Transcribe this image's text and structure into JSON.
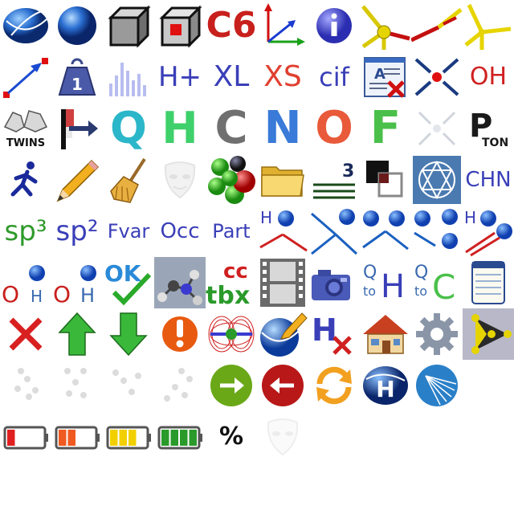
{
  "icons": {
    "r0": [
      "ellipsoid-icon",
      "sphere-icon",
      "cube-icon",
      "cube-with-atom-icon",
      "c6-label",
      "axes-icon",
      "info-icon",
      "bond-fragment-icon",
      "bond-fragment-2-icon",
      "bond-fragment-3-icon"
    ],
    "r1": [
      "arrow-bond-icon",
      "weight-1-icon",
      "histogram-icon",
      "h-plus-label",
      "xl-label",
      "xs-label",
      "cif-label",
      "text-remove-icon",
      "cross-atom-icon",
      "oh-label"
    ],
    "r2": [
      "twins-icon",
      "flag-arrow-icon",
      "q-letter-icon",
      "h-letter-icon",
      "c-letter-icon",
      "n-letter-icon",
      "o-letter-icon",
      "f-letter-icon",
      "collapse-arrows-icon",
      "pton-icon"
    ],
    "r3": [
      "run-icon",
      "pencil-icon",
      "broom-icon",
      "mask-icon",
      "atoms-cluster-icon",
      "folder-icon",
      "lines-3-icon",
      "overlap-squares-icon",
      "symmetry-icon",
      "chn-label"
    ],
    "r4": [
      "sp3-label",
      "sp2-label",
      "fvar-label",
      "occ-label",
      "part-label",
      "h-on-bond-icon",
      "bond-angle-icon",
      "bond-angle-2-icon",
      "bond-angle-3-icon",
      "h-atom-bond-icon"
    ],
    "r5": [
      "oh-bond-icon",
      "oh-bond-2-icon",
      "ok-check-icon",
      "molecule-photo-icon",
      "tbx-cc-icon",
      "film-icon",
      "camera-icon",
      "q-to-h-icon",
      "q-to-c-icon",
      "notepad-icon"
    ],
    "r6": [
      "close-icon",
      "arrow-up-icon",
      "arrow-down-icon",
      "warning-icon",
      "electron-density-icon",
      "sphere-pencil-icon",
      "h-remove-icon",
      "home-icon",
      "gear-icon",
      "pyramid-icon"
    ],
    "r7": [
      "dots-1-icon",
      "dots-2-icon",
      "dots-3-icon",
      "dots-4-icon",
      "go-forward-icon",
      "go-back-icon",
      "refresh-icon",
      "h-sphere-icon",
      "fan-icon"
    ],
    "r8": [
      "battery-low-icon",
      "battery-medium-icon",
      "battery-high-icon",
      "battery-full-icon",
      "percent-icon",
      "mask-faded-icon"
    ]
  },
  "labels": {
    "c6": "C6",
    "hplus": "H+",
    "xl": "XL",
    "xs": "XS",
    "cif": "cif",
    "oh": "OH",
    "twins": "TWINS",
    "q": "Q",
    "h": "H",
    "c": "C",
    "n": "N",
    "o": "O",
    "f": "F",
    "pton_p": "P",
    "pton_ton": "TON",
    "one": "1",
    "three": "3",
    "chn": "CHN",
    "sp3": "sp³",
    "sp2": "sp²",
    "fvar": "Fvar",
    "occ": "Occ",
    "part": "Part",
    "h_small": "H",
    "o_small": "O",
    "ok": "OK",
    "cc": "cc",
    "tbx": "tbx",
    "q_small": "Q",
    "to": "to",
    "c_small": "C",
    "percent": "%"
  },
  "colors": {
    "blue": "#3a3fb8",
    "red": "#c8201c",
    "green": "#2e9a2a",
    "teal": "#2bb7c9",
    "gray": "#6b6b6b",
    "yellow": "#f2d21b",
    "orange": "#f08a1a"
  },
  "batteries": [
    {
      "name": "battery-low-icon",
      "level": 0.25,
      "color": "#e02020"
    },
    {
      "name": "battery-medium-icon",
      "level": 0.5,
      "color": "#ef5a20"
    },
    {
      "name": "battery-high-icon",
      "level": 0.75,
      "color": "#f2d000"
    },
    {
      "name": "battery-full-icon",
      "level": 1.0,
      "color": "#2a9a2a"
    }
  ]
}
